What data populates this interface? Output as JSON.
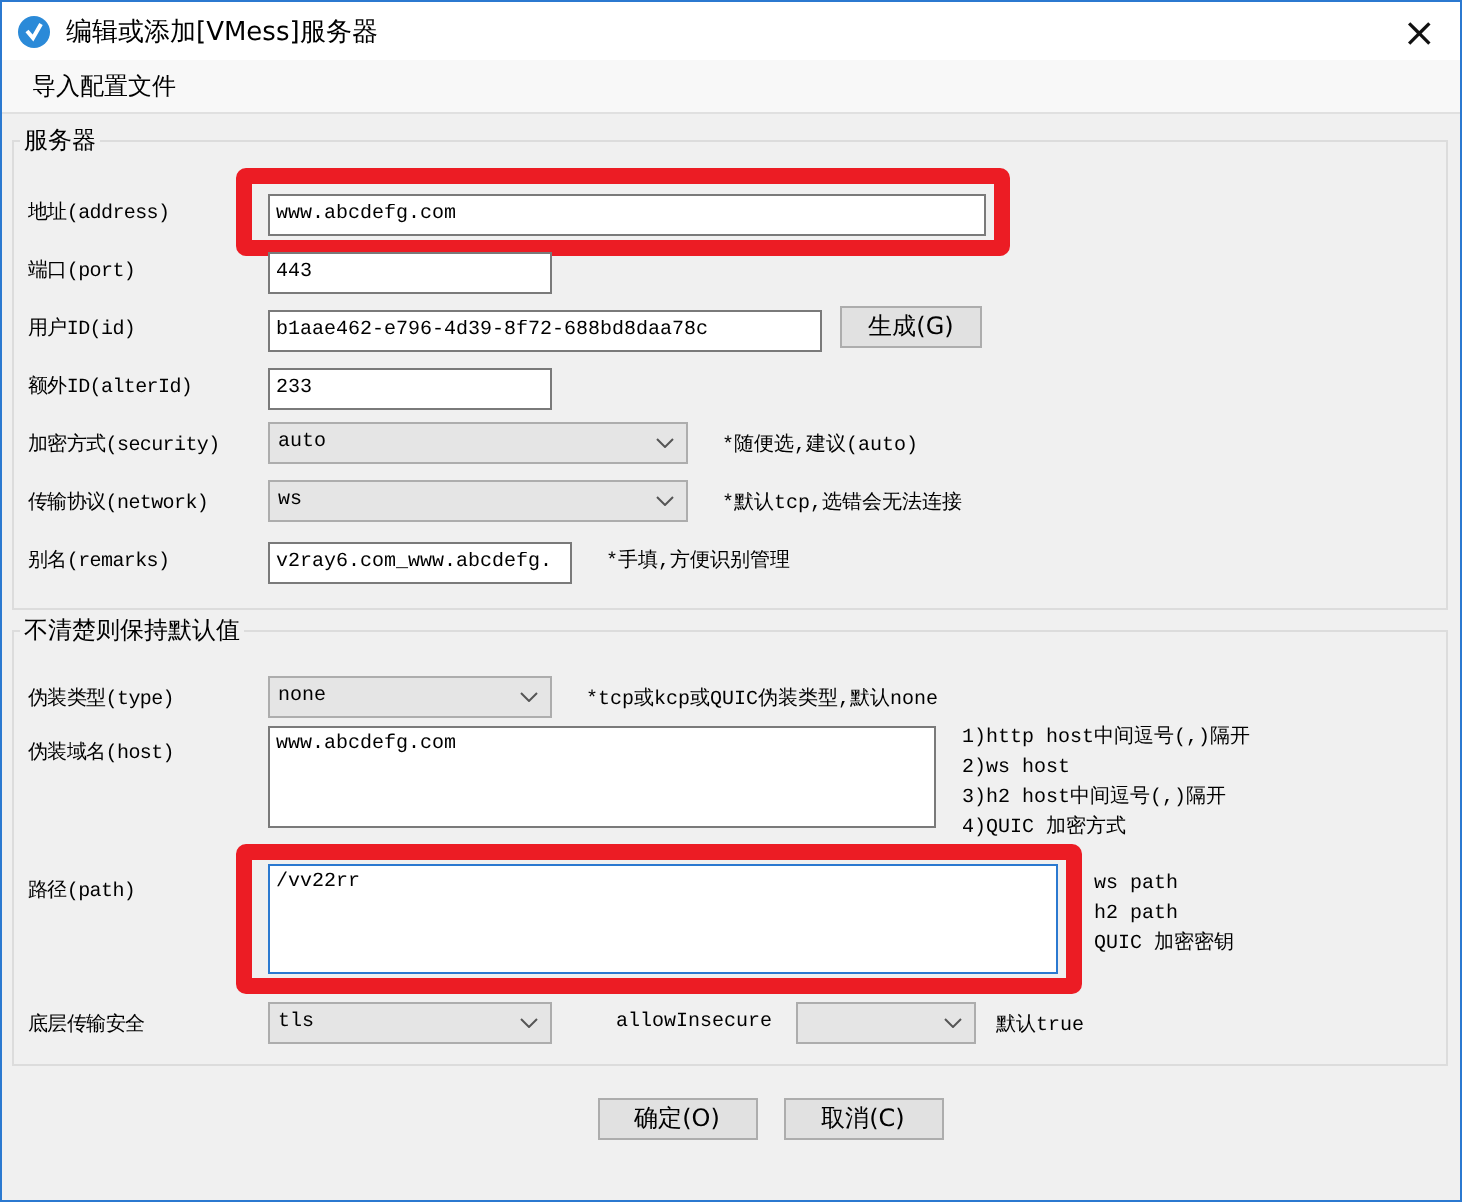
{
  "window": {
    "title": "编辑或添加[VMess]服务器",
    "close": "×"
  },
  "menu": [
    "导入配置文件"
  ],
  "server_group": {
    "legend": "服务器",
    "rows": [
      {
        "kind": "text",
        "label": "地址(address)",
        "value": "www.abcdefg.com",
        "highlighted": true
      },
      {
        "kind": "text",
        "label": "端口(port)",
        "value": "443",
        "highlighted": false
      },
      {
        "kind": "text",
        "label": "用户ID(id)",
        "value": "b1aae462-e796-4d39-8f72-688bd8daa78c",
        "button": "生成(G)",
        "highlighted": false
      },
      {
        "kind": "text",
        "label": "额外ID(alterId)",
        "value": "233",
        "highlighted": false
      },
      {
        "kind": "select",
        "label": "加密方式(security)",
        "value": "auto",
        "hint": "*随便选,建议(auto)",
        "highlighted": false
      },
      {
        "kind": "select",
        "label": "传输协议(network)",
        "value": "ws",
        "hint": "*默认tcp,选错会无法连接",
        "highlighted": false
      },
      {
        "kind": "text",
        "label": "别名(remarks)",
        "value": "v2ray6.com_www.abcdefg.",
        "hint": "*手填,方便识别管理",
        "highlighted": false
      }
    ]
  },
  "advanced_group": {
    "legend": "不清楚则保持默认值",
    "rows": [
      {
        "kind": "select",
        "label": "伪装类型(type)",
        "value": "none",
        "hint": "*tcp或kcp或QUIC伪装类型,默认none",
        "highlighted": false
      },
      {
        "kind": "textarea",
        "label": "伪装域名(host)",
        "value": "www.abcdefg.com",
        "hint_lines": [
          "1)http host中间逗号(,)隔开",
          "2)ws host",
          "3)h2 host中间逗号(,)隔开",
          "4)QUIC 加密方式"
        ],
        "focused": false,
        "highlighted": false
      },
      {
        "kind": "textarea",
        "label": "路径(path)",
        "value": "/vv22rr",
        "hint_lines": [
          "ws path",
          "h2 path",
          "QUIC 加密密钥"
        ],
        "focused": true,
        "highlighted": true
      },
      {
        "kind": "tls",
        "label": "底层传输安全",
        "value": "tls",
        "extra_label": "allowInsecure",
        "extra_hint": "默认true",
        "highlighted": false
      }
    ]
  },
  "buttons": [
    "确定(O)",
    "取消(C)"
  ]
}
